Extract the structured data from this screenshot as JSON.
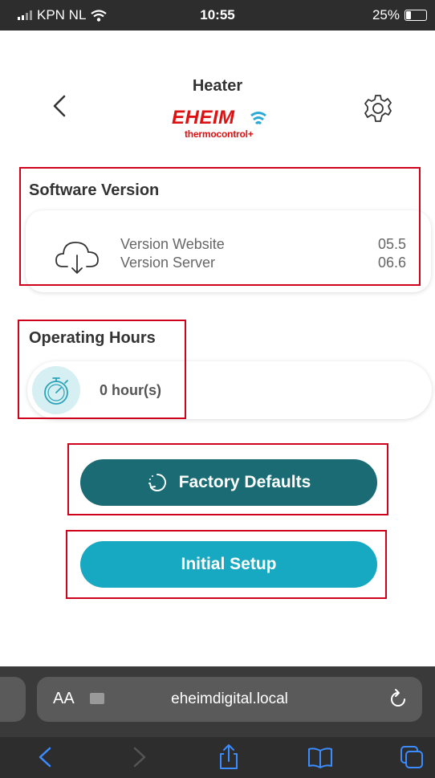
{
  "status_bar": {
    "carrier": "KPN NL",
    "time": "10:55",
    "battery": "25%"
  },
  "header": {
    "title": "Heater",
    "brand_logo": "EHEIM",
    "brand_sub": "thermocontrol+"
  },
  "software_version": {
    "title": "Software Version",
    "rows": [
      {
        "label": "Version Website",
        "value": "05.5"
      },
      {
        "label": "Version Server",
        "value": "06.6"
      }
    ]
  },
  "operating_hours": {
    "title": "Operating Hours",
    "value": "0 hour(s)"
  },
  "buttons": {
    "factory_defaults": "Factory Defaults",
    "initial_setup": "Initial Setup"
  },
  "browser": {
    "text_size": "AA",
    "url": "eheimdigital.local"
  },
  "colors": {
    "accent_dark": "#1a6b73",
    "accent_light": "#18a9c2",
    "brand_red": "#dd1111",
    "annotation_red": "#d0021b"
  },
  "icons": [
    "back-icon",
    "gear-icon",
    "cloud-download-icon",
    "stopwatch-icon",
    "reset-icon",
    "reload-icon",
    "share-icon",
    "bookmarks-icon",
    "tabs-icon"
  ]
}
